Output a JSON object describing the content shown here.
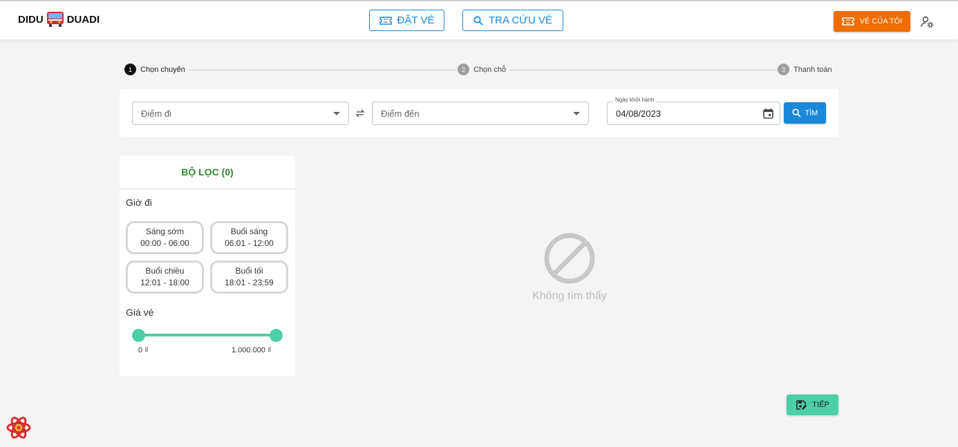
{
  "header": {
    "logo_left": "DIDU",
    "logo_right": "DUADI",
    "nav": {
      "book_label": "ĐẶT VÉ",
      "lookup_label": "TRA CỨU VÉ"
    },
    "my_tickets_label": "VÉ CỦA TÔI",
    "colors": {
      "primary": "#1a88d8",
      "accent": "#ef6c00"
    }
  },
  "stepper": {
    "steps": [
      {
        "num": "1",
        "label": "Chọn chuyến",
        "active": true
      },
      {
        "num": "2",
        "label": "Chọn chỗ",
        "active": false
      },
      {
        "num": "3",
        "label": "Thanh toán",
        "active": false
      }
    ]
  },
  "search": {
    "from_placeholder": "Điểm đi",
    "to_placeholder": "Điểm đến",
    "date_label": "Ngày khởi hành",
    "date_value": "04/08/2023",
    "search_button": "TÌM"
  },
  "filter": {
    "title": "BỘ LỌC (0)",
    "departure_label": "Giờ đi",
    "time_slots": [
      {
        "name": "Sáng sớm",
        "range": "00:00 - 06:00"
      },
      {
        "name": "Buổi sáng",
        "range": "06:01 - 12:00"
      },
      {
        "name": "Buổi chiều",
        "range": "12:01 - 18:00"
      },
      {
        "name": "Buổi tối",
        "range": "18:01 - 23:59"
      }
    ],
    "price_label": "Giá vé",
    "price_min": "0 ₫",
    "price_max": "1.000.000 ₫",
    "slider_color": "#4ccfa6"
  },
  "results": {
    "empty_text": "Không tìm thấy",
    "empty_icon": "block-icon"
  },
  "footer": {
    "next_button": "TIẾP",
    "next_icon": "save-edit-icon"
  }
}
